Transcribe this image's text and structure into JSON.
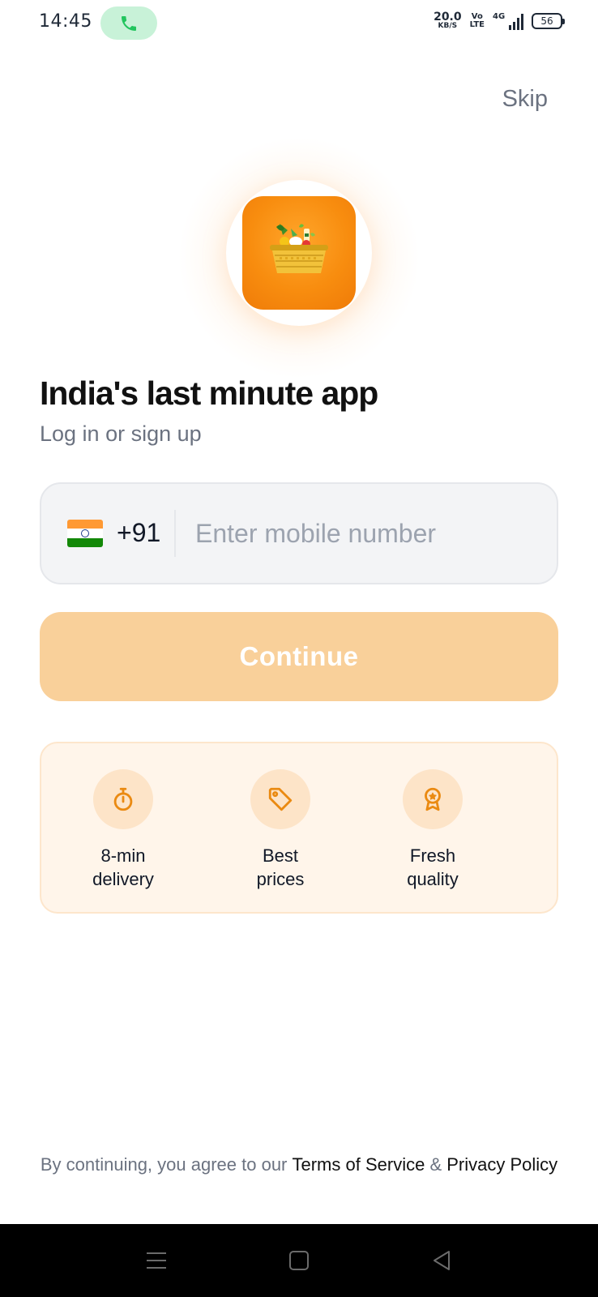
{
  "status_bar": {
    "time": "14:45",
    "net_speed_value": "20.0",
    "net_speed_unit": "KB/S",
    "volte_top": "Vo",
    "volte_bottom": "LTE",
    "network_type": "4G",
    "battery_level": "56"
  },
  "header": {
    "skip_label": "Skip"
  },
  "hero": {
    "title": "India's last minute app",
    "subtitle": "Log in or sign up"
  },
  "phone": {
    "country_code": "+91",
    "placeholder": "Enter mobile number",
    "value": ""
  },
  "continue_label": "Continue",
  "features": [
    {
      "icon": "stopwatch-icon",
      "line1": "8-min",
      "line2": "delivery"
    },
    {
      "icon": "price-tag-icon",
      "line1": "Best",
      "line2": "prices"
    },
    {
      "icon": "quality-badge-icon",
      "line1": "Fresh",
      "line2": "quality"
    }
  ],
  "legal": {
    "prefix": "By continuing, you agree to our ",
    "terms": "Terms of Service",
    "amp": " & ",
    "privacy": "Privacy Policy"
  },
  "colors": {
    "accent": "#F88D0F",
    "button_disabled": "#F9D09A",
    "feature_bg": "#FFF5EA",
    "call_pill": "#C8F2D8"
  }
}
